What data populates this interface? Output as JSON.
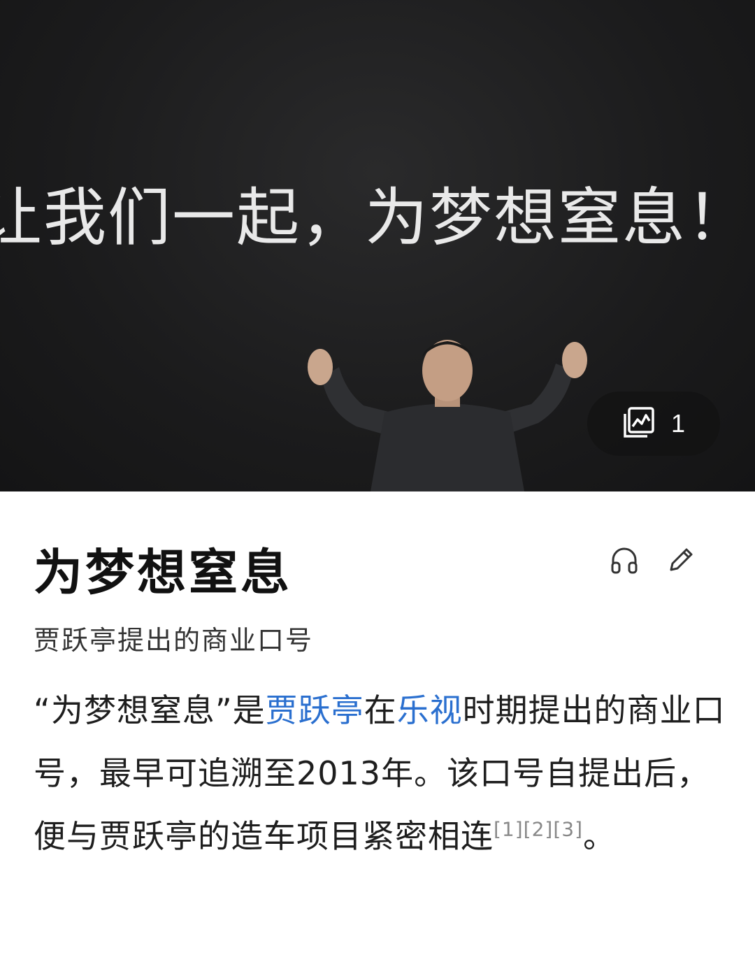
{
  "hero": {
    "slogan_text": "让我们一起，为梦想窒息！",
    "gallery": {
      "icon": "image-gallery-icon",
      "count": "1"
    }
  },
  "article": {
    "title": "为梦想窒息",
    "actions": {
      "listen_icon": "headphones-icon",
      "edit_icon": "pencil-icon"
    },
    "subtitle": "贾跃亭提出的商业口号",
    "paragraph": {
      "text_1": "“为梦想窒息”是",
      "link_1": "贾跃亭",
      "text_2": "在",
      "link_2": "乐视",
      "text_3": "时期提出的商业口号，最早可追溯至2013年。该口号自提出后，便与贾跃亭的造车项目紧密相连",
      "refs": [
        "[1]",
        "[2]",
        "[3]"
      ],
      "text_end": "。"
    }
  },
  "colors": {
    "link": "#2a6fcf",
    "hero_bg": "#1b1b1c"
  }
}
